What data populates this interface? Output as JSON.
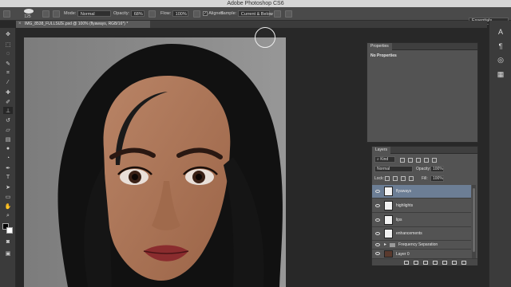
{
  "app": {
    "title": "Adobe Photoshop CS6"
  },
  "options_bar": {
    "brush_size": "125",
    "mode_label": "Mode:",
    "mode_value": "Normal",
    "opacity_label": "Opacity:",
    "opacity_value": "68%",
    "flow_label": "Flow:",
    "flow_value": "100%",
    "aligned_label": "Aligned",
    "sample_label": "Sample:",
    "sample_value": "Current & Below",
    "workspace": "Essentials"
  },
  "document_tab": {
    "title": "IMG_8538_FULLSIZE.psd @ 100% (flyaways, RGB/16*) *",
    "close": "×"
  },
  "properties_panel": {
    "tab": "Properties",
    "message": "No Properties"
  },
  "layers_panel": {
    "tab": "Layers",
    "filter_kind": "Kind",
    "blend_mode": "Normal",
    "opacity_label": "Opacity:",
    "opacity_value": "100%",
    "lock_label": "Lock:",
    "fill_label": "Fill:",
    "fill_value": "100%",
    "layers": [
      {
        "name": "flyaways",
        "selected": true,
        "type": "layer"
      },
      {
        "name": "highlights",
        "selected": false,
        "type": "layer"
      },
      {
        "name": "lips",
        "selected": false,
        "type": "layer"
      },
      {
        "name": "enhancements",
        "selected": false,
        "type": "layer"
      },
      {
        "name": "Frequency Separation",
        "selected": false,
        "type": "group"
      },
      {
        "name": "Layer 0",
        "selected": false,
        "type": "image"
      }
    ]
  },
  "colors": {
    "selection": "#6c7e95",
    "panel": "#535353",
    "workspace": "#282828",
    "canvas_bg": "#8a8a8a"
  }
}
